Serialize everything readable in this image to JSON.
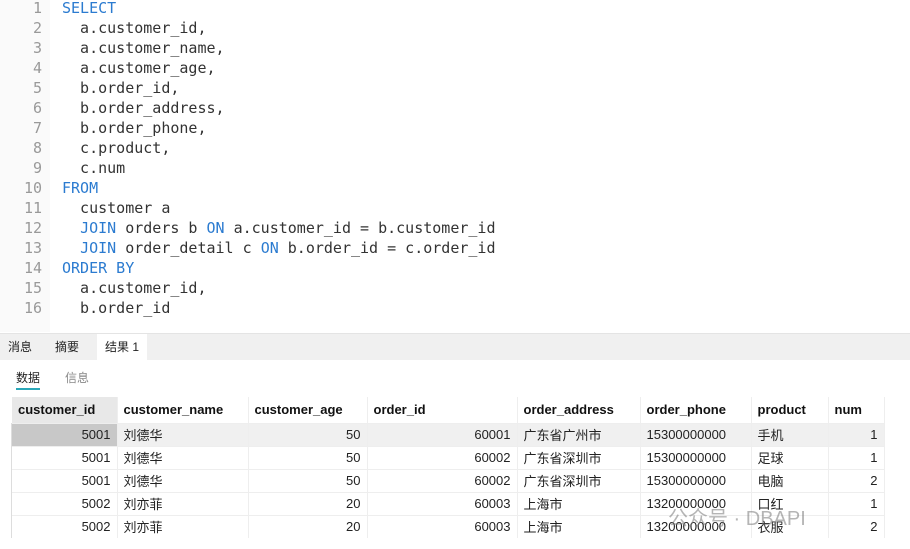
{
  "editor": {
    "lines": [
      [
        {
          "t": "SELECT",
          "k": 1
        }
      ],
      [
        {
          "t": "  a.customer_id,"
        }
      ],
      [
        {
          "t": "  a.customer_name,"
        }
      ],
      [
        {
          "t": "  a.customer_age,"
        }
      ],
      [
        {
          "t": "  b.order_id,"
        }
      ],
      [
        {
          "t": "  b.order_address,"
        }
      ],
      [
        {
          "t": "  b.order_phone,"
        }
      ],
      [
        {
          "t": "  c.product,"
        }
      ],
      [
        {
          "t": "  c.num"
        }
      ],
      [
        {
          "t": "FROM",
          "k": 1
        }
      ],
      [
        {
          "t": "  customer a"
        }
      ],
      [
        {
          "t": "  "
        },
        {
          "t": "JOIN",
          "k": 1
        },
        {
          "t": " orders b "
        },
        {
          "t": "ON",
          "k": 1
        },
        {
          "t": " a.customer_id = b.customer_id"
        }
      ],
      [
        {
          "t": "  "
        },
        {
          "t": "JOIN",
          "k": 1
        },
        {
          "t": " order_detail c "
        },
        {
          "t": "ON",
          "k": 1
        },
        {
          "t": " b.order_id = c.order_id"
        }
      ],
      [
        {
          "t": "ORDER BY",
          "k": 1
        }
      ],
      [
        {
          "t": "  a.customer_id,"
        }
      ],
      [
        {
          "t": "  b.order_id"
        }
      ]
    ]
  },
  "tabs": [
    {
      "label": "消息"
    },
    {
      "label": "摘要"
    },
    {
      "label": "结果 1",
      "active": true
    }
  ],
  "subtabs": [
    {
      "label": "数据",
      "active": true
    },
    {
      "label": "信息"
    }
  ],
  "grid": {
    "columns": [
      "customer_id",
      "customer_name",
      "customer_age",
      "order_id",
      "order_address",
      "order_phone",
      "product",
      "num"
    ],
    "rows": [
      [
        "5001",
        "刘德华",
        "50",
        "60001",
        "广东省广州市",
        "15300000000",
        "手机",
        "1"
      ],
      [
        "5001",
        "刘德华",
        "50",
        "60002",
        "广东省深圳市",
        "15300000000",
        "足球",
        "1"
      ],
      [
        "5001",
        "刘德华",
        "50",
        "60002",
        "广东省深圳市",
        "15300000000",
        "电脑",
        "2"
      ],
      [
        "5002",
        "刘亦菲",
        "20",
        "60003",
        "上海市",
        "13200000000",
        "口红",
        "1"
      ],
      [
        "5002",
        "刘亦菲",
        "20",
        "60003",
        "上海市",
        "13200000000",
        "衣服",
        "2"
      ]
    ]
  },
  "watermark": "公众号 · DBAPI"
}
